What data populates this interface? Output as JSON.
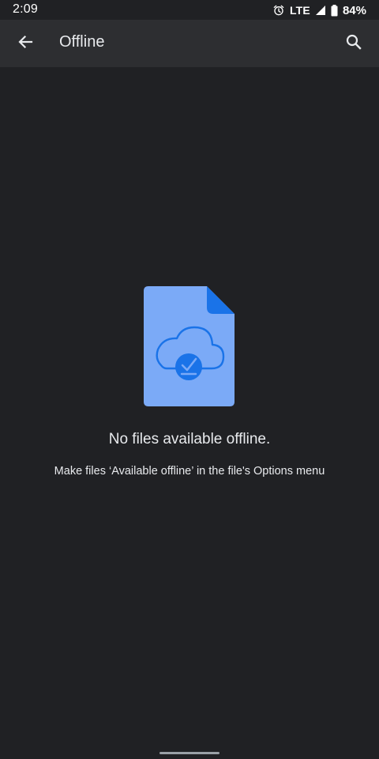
{
  "status_bar": {
    "time": "2:09",
    "network": "LTE",
    "battery": "84%",
    "icons": [
      "alarm-icon",
      "signal-icon",
      "battery-icon"
    ]
  },
  "app_bar": {
    "title": "Offline",
    "back_icon": "arrow-back-icon",
    "search_icon": "search-icon"
  },
  "empty_state": {
    "illustration": "offline-file-cloud-icon",
    "title": "No files available offline.",
    "subtitle": "Make files ‘Available offline’ in the file's Options menu"
  },
  "colors": {
    "background": "#202124",
    "app_bar": "#2d2e31",
    "file_body": "#7baaf7",
    "file_corner": "#1a73e8",
    "cloud_stroke": "#1a73e8",
    "text": "#e8eaed"
  }
}
